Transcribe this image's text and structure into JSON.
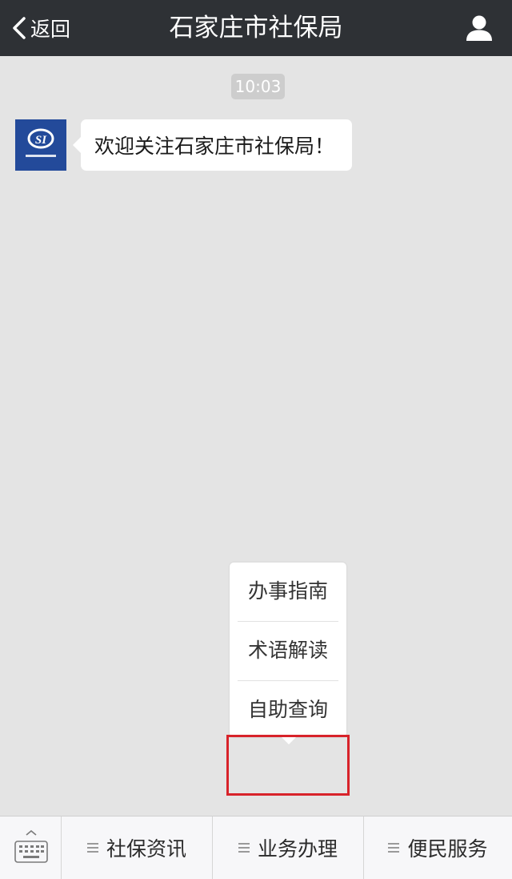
{
  "header": {
    "back_label": "返回",
    "title": "石家庄市社保局"
  },
  "chat": {
    "timestamp": "10:03",
    "message": "欢迎关注石家庄市社保局！",
    "avatar_text": "SI"
  },
  "submenu": {
    "items": [
      {
        "label": "办事指南"
      },
      {
        "label": "术语解读"
      },
      {
        "label": "自助查询",
        "highlighted": true
      }
    ]
  },
  "menu_bar": {
    "tabs": [
      {
        "label": "社保资讯"
      },
      {
        "label": "业务办理",
        "active": true
      },
      {
        "label": "便民服务"
      }
    ]
  },
  "colors": {
    "navbar": "#2e3135",
    "chat_background": "#e4e4e4",
    "avatar": "#234a9a",
    "highlight": "#d8232a"
  }
}
